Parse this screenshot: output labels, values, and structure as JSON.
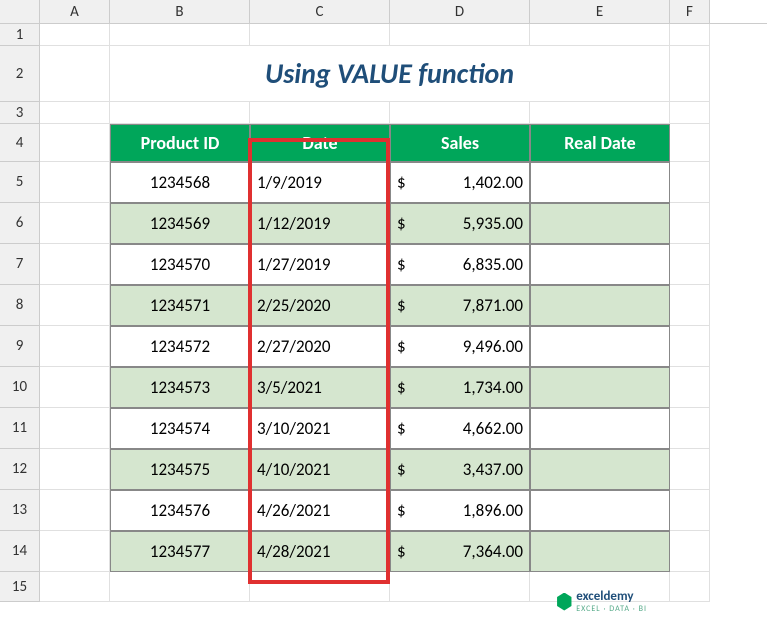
{
  "columns": [
    "A",
    "B",
    "C",
    "D",
    "E",
    "F"
  ],
  "rows": [
    "1",
    "2",
    "3",
    "4",
    "5",
    "6",
    "7",
    "8",
    "9",
    "10",
    "11",
    "12",
    "13",
    "14",
    "15"
  ],
  "title": "Using VALUE function",
  "headers": {
    "product_id": "Product ID",
    "date": "Date",
    "sales": "Sales",
    "real_date": "Real Date"
  },
  "currency": "$",
  "chart_data": {
    "type": "table",
    "rows": [
      {
        "product_id": "1234568",
        "date": "1/9/2019",
        "sales": "1,402.00",
        "real_date": ""
      },
      {
        "product_id": "1234569",
        "date": "1/12/2019",
        "sales": "5,935.00",
        "real_date": ""
      },
      {
        "product_id": "1234570",
        "date": "1/27/2019",
        "sales": "6,835.00",
        "real_date": ""
      },
      {
        "product_id": "1234571",
        "date": "2/25/2020",
        "sales": "7,871.00",
        "real_date": ""
      },
      {
        "product_id": "1234572",
        "date": "2/27/2020",
        "sales": "9,496.00",
        "real_date": ""
      },
      {
        "product_id": "1234573",
        "date": "3/5/2021",
        "sales": "1,734.00",
        "real_date": ""
      },
      {
        "product_id": "1234574",
        "date": "3/10/2021",
        "sales": "4,662.00",
        "real_date": ""
      },
      {
        "product_id": "1234575",
        "date": "4/10/2021",
        "sales": "3,437.00",
        "real_date": ""
      },
      {
        "product_id": "1234576",
        "date": "4/26/2021",
        "sales": "1,896.00",
        "real_date": ""
      },
      {
        "product_id": "1234577",
        "date": "4/28/2021",
        "sales": "7,364.00",
        "real_date": ""
      }
    ]
  },
  "logo": {
    "text": "exceldemy",
    "subtitle": "EXCEL · DATA · BI"
  }
}
